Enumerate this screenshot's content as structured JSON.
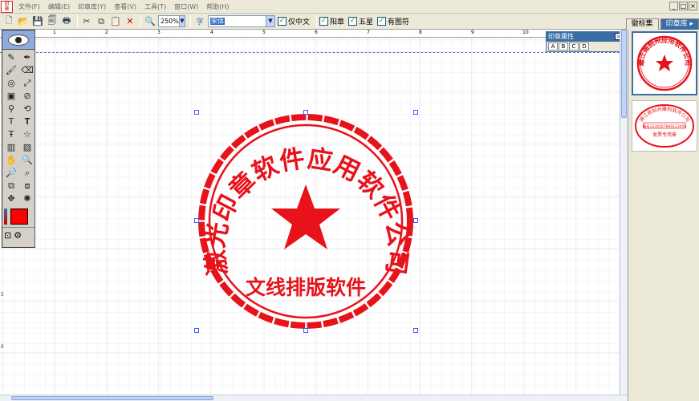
{
  "app": {
    "icon_text": "印章\n软件"
  },
  "menu": {
    "items": [
      "文件(F)",
      "编辑(E)",
      "印章库(Y)",
      "查看(V)",
      "工具(T)",
      "窗口(W)",
      "帮助(H)"
    ]
  },
  "window_buttons": [
    "_",
    "□",
    "×"
  ],
  "toolbar": {
    "zoom_value": "250%",
    "font_value": "宋体",
    "check_chinese_only": "仅中文",
    "check_yang": "阳章",
    "check_star": "五星",
    "check_pattern": "有图符"
  },
  "right_tabs": [
    "徽标集",
    "印章库"
  ],
  "props_panel": {
    "title": "印章属性",
    "tabs": [
      "A",
      "B",
      "C",
      "D"
    ]
  },
  "ruler": {
    "top": [
      "1",
      "2",
      "3",
      "4",
      "5",
      "6",
      "7",
      "8",
      "9",
      "10"
    ],
    "left": [
      "5",
      "6"
    ]
  },
  "stamp": {
    "outer_text": "激光印章软件应用软件公司",
    "bottom_text": "文线排版软件",
    "color": "#e8121a"
  },
  "library": {
    "item1_text": "雕江南刻州应用软件公司",
    "item2_text": "湖江南刻州雕刻软件公司",
    "item2_code": "编号1234567890123456",
    "item2_label": "发票专用章"
  }
}
